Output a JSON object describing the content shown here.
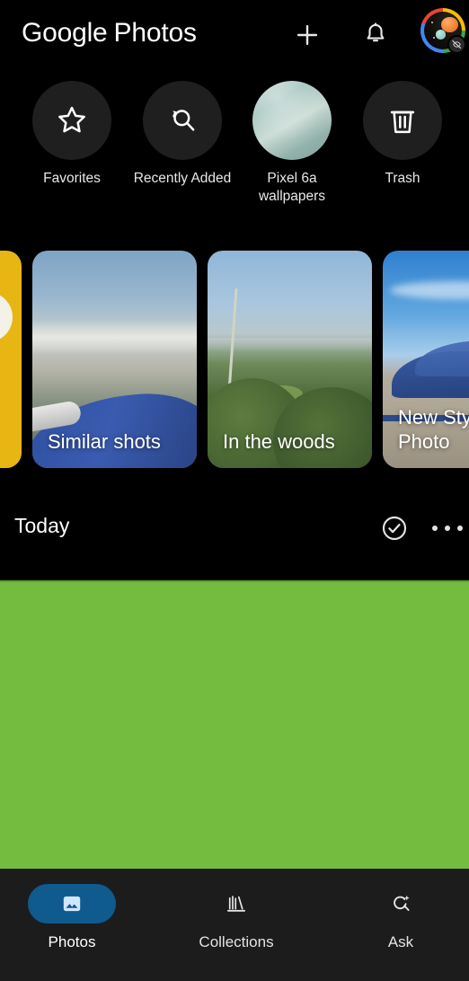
{
  "app": {
    "brand_google": "Google",
    "brand_photos": "Photos",
    "background_color": "#000000",
    "accent_color": "#0F5A8F",
    "grid_placeholder_color": "#74BC40"
  },
  "header": {
    "add_label": "add-icon",
    "notifications_label": "bell-icon",
    "avatar_label": "account-avatar",
    "avatar_badge": "paused-eye-off"
  },
  "quick_access": [
    {
      "label": "Favorites",
      "icon": "star-icon"
    },
    {
      "label": "Recently\nAdded",
      "icon": "recent-search-icon"
    },
    {
      "label": "Pixel 6a\nwallpapers",
      "icon": "photo-thumbnail"
    },
    {
      "label": "Trash",
      "icon": "trash-icon"
    }
  ],
  "memories": [
    {
      "title": "",
      "kind": "yellow-card"
    },
    {
      "title": "Similar shots",
      "kind": "photo-card"
    },
    {
      "title": "In the woods",
      "kind": "photo-card"
    },
    {
      "title": "New Sty\nPhoto",
      "kind": "photo-card"
    }
  ],
  "today_section": {
    "title": "Today",
    "select_icon": "check-circle-icon",
    "more_icon": "more-horizontal-icon"
  },
  "bottom_nav": [
    {
      "label": "Photos",
      "icon": "photo-icon",
      "active": true
    },
    {
      "label": "Collections",
      "icon": "collections-icon",
      "active": false
    },
    {
      "label": "Ask",
      "icon": "ask-sparkle-icon",
      "active": false
    }
  ]
}
